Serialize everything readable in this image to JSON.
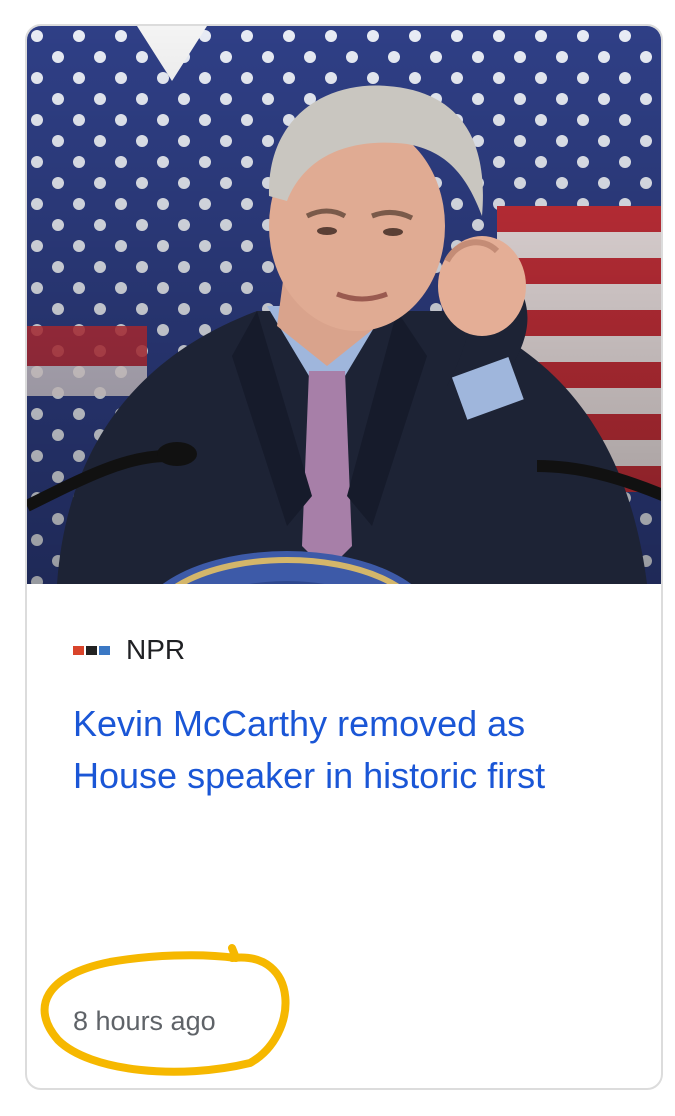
{
  "article": {
    "source": "NPR",
    "source_logo": "npr-logo-icon",
    "headline": "Kevin McCarthy removed as House speaker in historic first",
    "timestamp": "8 hours ago",
    "image": "news-photo"
  },
  "colors": {
    "headline": "#1a56d6",
    "source_text": "#202124",
    "timestamp": "#5f6368",
    "annotation": "#f6b800",
    "card_border": "#dcdcdc",
    "npr_logo": [
      "#d9442b",
      "#222222",
      "#3b78c4"
    ]
  }
}
